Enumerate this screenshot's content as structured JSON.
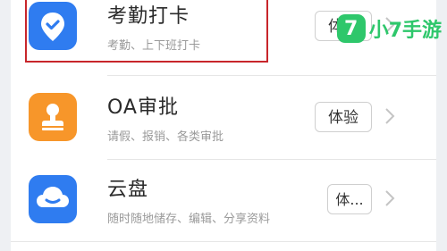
{
  "rows": [
    {
      "title": "考勤打卡",
      "subtitle": "考勤、上下班打卡",
      "button": "体验",
      "icon": "location-check-icon",
      "color": "#2f7cf0"
    },
    {
      "title": "OA审批",
      "subtitle": "请假、报销、各类审批",
      "button": "体验",
      "icon": "approval-stamp-icon",
      "color": "#f7962a"
    },
    {
      "title": "云盘",
      "subtitle": "随时随地储存、编辑、分享资料",
      "button": "体...",
      "icon": "cloud-icon",
      "color": "#2f7cf0"
    }
  ],
  "watermark": {
    "badge": "7",
    "text": "小7手游",
    "color": "#2ec76b"
  },
  "highlight_color": "#c8262b"
}
